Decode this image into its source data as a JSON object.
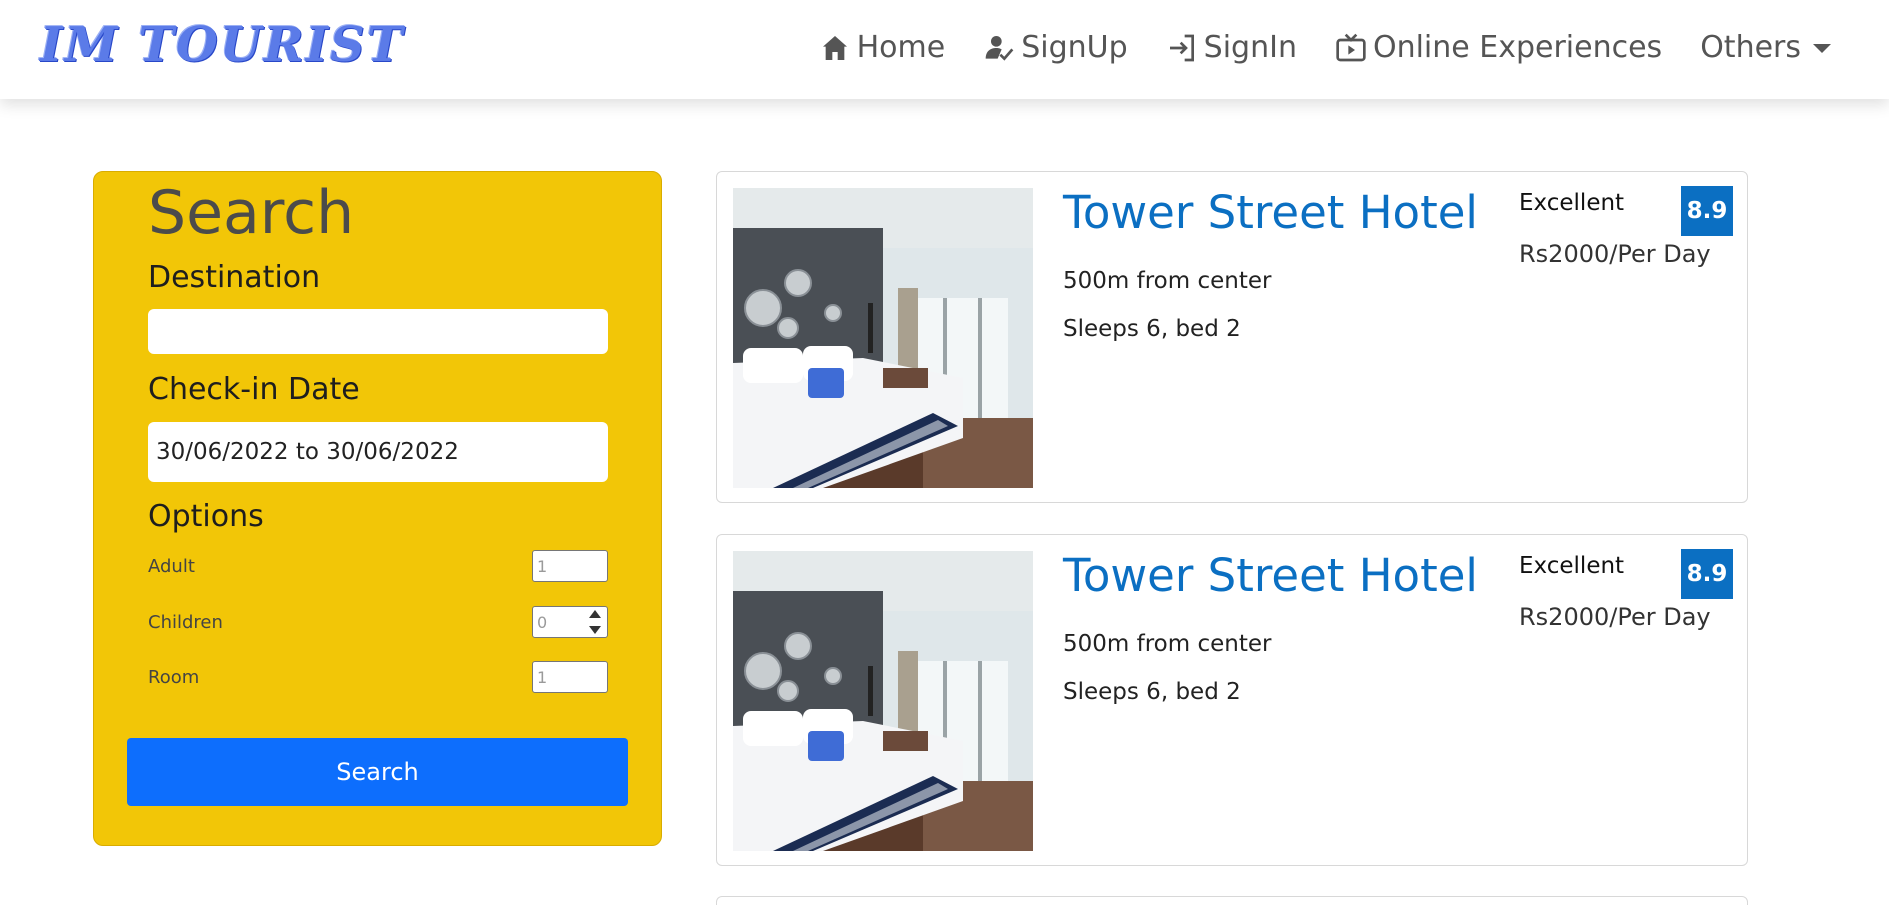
{
  "brand": {
    "logo_text": "IM TOURIST"
  },
  "nav": {
    "items": [
      {
        "label": "Home",
        "icon": "home-icon"
      },
      {
        "label": "SignUp",
        "icon": "user-check-icon"
      },
      {
        "label": "SignIn",
        "icon": "sign-in-icon"
      },
      {
        "label": "Online Experiences",
        "icon": "tv-play-icon"
      },
      {
        "label": "Others",
        "icon": "caret-down-icon"
      }
    ]
  },
  "search": {
    "title": "Search",
    "destination_label": "Destination",
    "destination_value": "",
    "checkin_label": "Check-in Date",
    "checkin_value": "30/06/2022 to 30/06/2022",
    "options_label": "Options",
    "options": [
      {
        "label": "Adult",
        "value": "1"
      },
      {
        "label": "Children",
        "value": "0"
      },
      {
        "label": "Room",
        "value": "1"
      }
    ],
    "button_label": "Search",
    "panel_color": "#f2c607",
    "button_color": "#0d6efd"
  },
  "results": [
    {
      "name": "Tower Street Hotel",
      "distance": "500m from center",
      "sleeps": "Sleeps 6, bed 2",
      "rating_text": "Excellent",
      "rating_score": "8.9",
      "price": "Rs2000/Per Day"
    },
    {
      "name": "Tower Street Hotel",
      "distance": "500m from center",
      "sleeps": "Sleeps 6, bed 2",
      "rating_text": "Excellent",
      "rating_score": "8.9",
      "price": "Rs2000/Per Day"
    }
  ],
  "accent_color": "#0b6fc2"
}
